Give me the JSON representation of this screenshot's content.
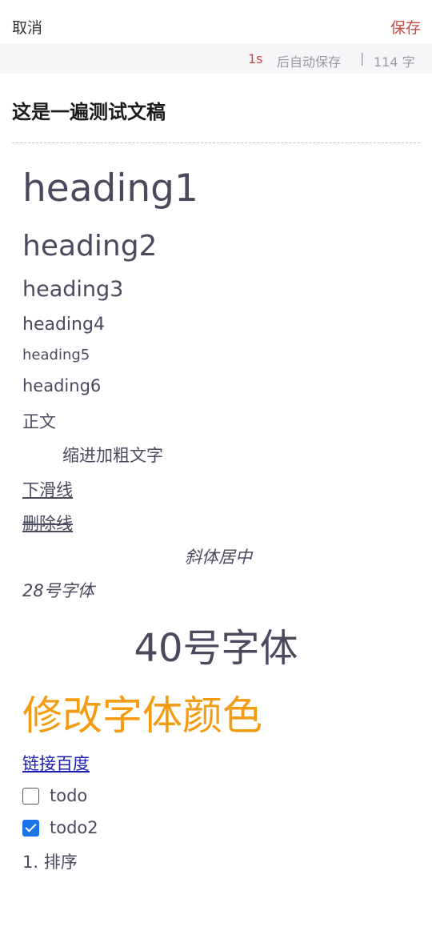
{
  "topbar": {
    "cancel_label": "取消",
    "save_label": "保存"
  },
  "infobar": {
    "seconds": "1s",
    "autosave_label": "后自动保存",
    "separator": "|",
    "word_count": "114 字"
  },
  "document": {
    "title": "这是一遍测试文稿",
    "heading1": "heading1",
    "heading2": "heading2",
    "heading3": "heading3",
    "heading4": "heading4",
    "heading5": "heading5",
    "heading6": "heading6",
    "body_text": "正文",
    "indent_bold": "缩进加粗文字",
    "underline_text": "下滑线",
    "strike_text": "删除线",
    "italic_center": "斜体居中",
    "italic_28": "28号字体",
    "size40_text": "40号字体",
    "colored_text": "修改字体颜色",
    "colored_text_color": "#f39c12",
    "link_text": "链接百度",
    "todos": [
      {
        "label": "todo",
        "checked": false
      },
      {
        "label": "todo2",
        "checked": true
      }
    ],
    "ordered_item": "1.  排序"
  }
}
